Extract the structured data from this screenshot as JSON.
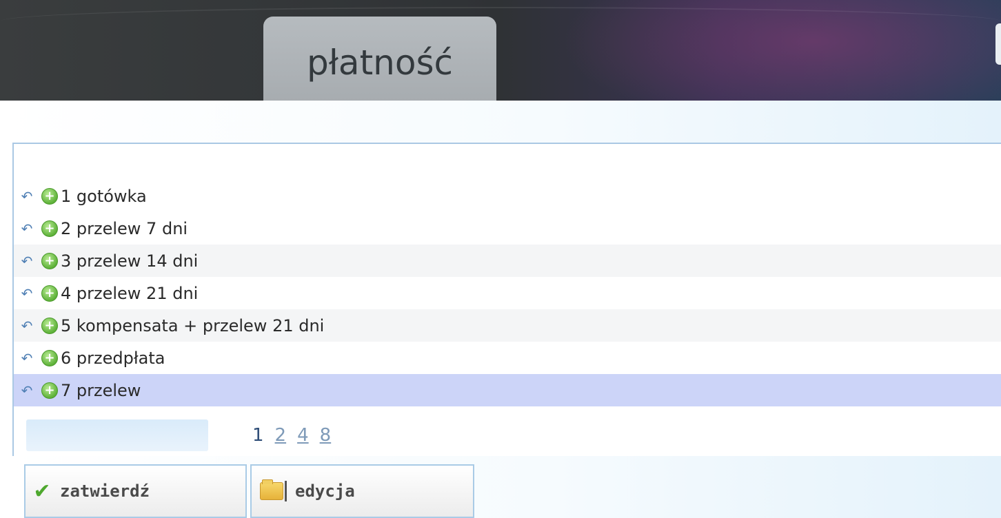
{
  "header": {
    "tab_title": "płatność"
  },
  "list": {
    "rows": [
      {
        "label": "1 gotówka",
        "selected": false
      },
      {
        "label": "2 przelew 7 dni",
        "selected": false
      },
      {
        "label": "3 przelew 14 dni",
        "selected": false
      },
      {
        "label": "4 przelew 21 dni",
        "selected": false
      },
      {
        "label": "5 kompensata + przelew 21 dni",
        "selected": false
      },
      {
        "label": "6 przedpłata",
        "selected": false
      },
      {
        "label": "7 przelew",
        "selected": true
      }
    ],
    "row_icons": {
      "back": "back-arrow-icon",
      "add": "green-plus-icon",
      "edge": "scroll-marker-icon"
    }
  },
  "pager": {
    "field_value": "",
    "pages": [
      "1",
      "2",
      "4",
      "8"
    ],
    "current_page": "1"
  },
  "buttons": {
    "confirm_label": "zatwierdź",
    "confirm_icon": "checkmark-icon",
    "edit_label": "edycja",
    "edit_icon": "folder-edit-icon"
  },
  "colors": {
    "selected_row": "#ccd4f8",
    "panel_border": "#aac8e4",
    "check_green": "#4ea82e"
  }
}
